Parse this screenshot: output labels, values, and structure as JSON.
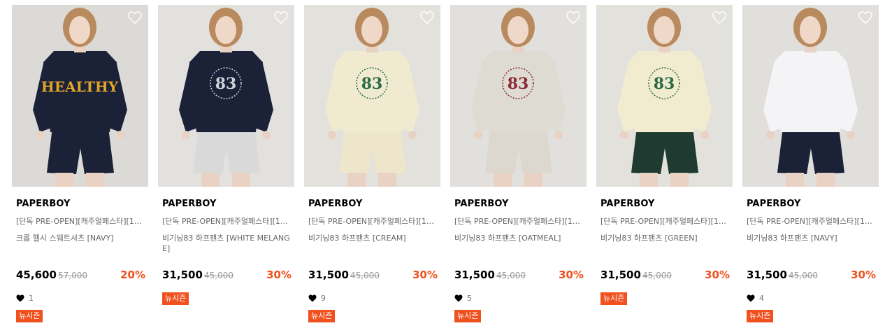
{
  "products": [
    {
      "brand": "PAPERBOY",
      "name_line1": "[단독 PRE-OPEN][캐주얼페스타][10…",
      "name_line2": "크롭 헬시 스웨트셔츠 [NAVY]",
      "price": "45,600",
      "original_price": "57,000",
      "discount": "20%",
      "likes": "1",
      "badge": "뉴시즌",
      "colors": {
        "bg": "#dcdad6",
        "top": "#1b2238",
        "bottom": "#1b2238",
        "print": "#e0a42a"
      },
      "print_text": "HEALTHY"
    },
    {
      "brand": "PAPERBOY",
      "name_line1": "[단독 PRE-OPEN][캐주얼페스타][10…",
      "name_line2": "비기닝83 하프팬츠 [WHITE MELANGE]",
      "price": "31,500",
      "original_price": "45,000",
      "discount": "30%",
      "likes": "",
      "badge": "뉴시즌",
      "colors": {
        "bg": "#e2e1de",
        "top": "#1b2238",
        "bottom": "#d9d9d9",
        "print": "#cfd3da"
      },
      "print_text": "83"
    },
    {
      "brand": "PAPERBOY",
      "name_line1": "[단독 PRE-OPEN][캐주얼페스타][10…",
      "name_line2": "비기닝83 하프팬츠 [CREAM]",
      "price": "31,500",
      "original_price": "45,000",
      "discount": "30%",
      "likes": "9",
      "badge": "뉴시즌",
      "colors": {
        "bg": "#e3e1dc",
        "top": "#f0ead0",
        "bottom": "#ede6cb",
        "print": "#2a6b45"
      },
      "print_text": "83"
    },
    {
      "brand": "PAPERBOY",
      "name_line1": "[단독 PRE-OPEN][캐주얼페스타][10…",
      "name_line2": "비기닝83 하프팬츠 [OATMEAL]",
      "price": "31,500",
      "original_price": "45,000",
      "discount": "30%",
      "likes": "5",
      "badge": "뉴시즌",
      "colors": {
        "bg": "#e2e0dc",
        "top": "#dedbd3",
        "bottom": "#dcd8cf",
        "print": "#8a2a35"
      },
      "print_text": "83"
    },
    {
      "brand": "PAPERBOY",
      "name_line1": "[단독 PRE-OPEN][캐주얼페스타][10…",
      "name_line2": "비기닝83 하프팬츠 [GREEN]",
      "price": "31,500",
      "original_price": "45,000",
      "discount": "30%",
      "likes": "",
      "badge": "뉴시즌",
      "colors": {
        "bg": "#e3e1dc",
        "top": "#f1ebcf",
        "bottom": "#1f3a30",
        "print": "#2a6b45"
      },
      "print_text": "83"
    },
    {
      "brand": "PAPERBOY",
      "name_line1": "[단독 PRE-OPEN][캐주얼페스타][10…",
      "name_line2": "비기닝83 하프팬츠 [NAVY]",
      "price": "31,500",
      "original_price": "45,000",
      "discount": "30%",
      "likes": "4",
      "badge": "뉴시즌",
      "colors": {
        "bg": "#e0dfdc",
        "top": "#f4f4f6",
        "bottom": "#1b2238",
        "print": "#1b2238"
      },
      "print_text": ""
    }
  ],
  "colors": {
    "accent": "#f0511e",
    "heart": "#000000",
    "wish_icon": "#ffffff"
  },
  "icons": {
    "wishlist": "heart-outline-icon",
    "like": "heart-filled-icon"
  }
}
